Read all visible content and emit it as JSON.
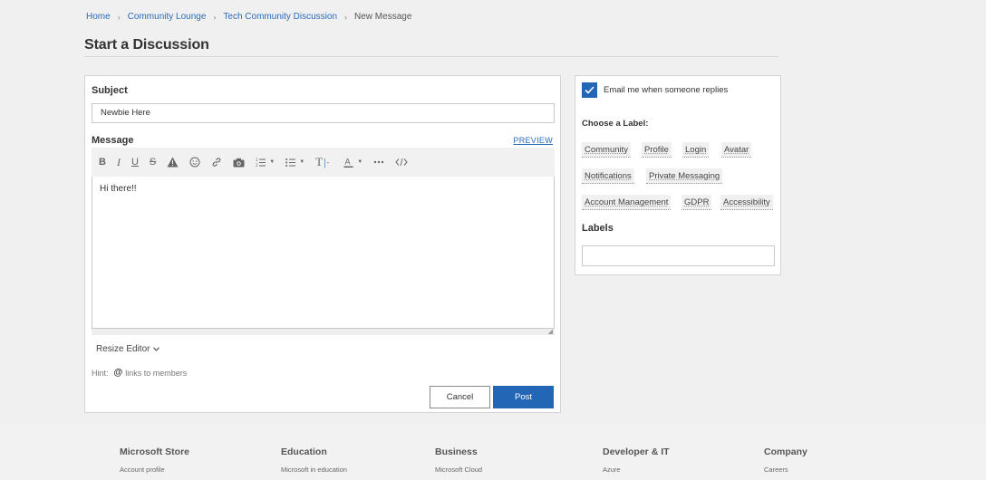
{
  "breadcrumb": {
    "home": "Home",
    "lounge": "Community Lounge",
    "discussion": "Tech Community Discussion",
    "current": "New Message"
  },
  "page_title": "Start a Discussion",
  "compose": {
    "subject_label": "Subject",
    "subject_value": "Newbie Here",
    "message_label": "Message",
    "preview_label": "PREVIEW",
    "toolbar": {
      "bold": "B",
      "italic": "I",
      "underline": "U",
      "strike": "S",
      "font_size": "T"
    },
    "editor_text": "Hi there!!",
    "resize_label": "Resize Editor",
    "hint_prefix": "Hint:",
    "hint_at": "@",
    "hint_text": "links to members",
    "cancel_label": "Cancel",
    "post_label": "Post"
  },
  "sidebar": {
    "email_checked": true,
    "email_label": "Email me when someone replies",
    "choose_label": "Choose a Label:",
    "tags": [
      "Community",
      "Profile",
      "Login",
      "Avatar",
      "Notifications",
      "Private Messaging",
      "Account Management",
      "GDPR",
      "Accessibility"
    ],
    "labels_title": "Labels",
    "labels_value": ""
  },
  "footer": {
    "columns": [
      {
        "heading": "Microsoft Store",
        "link": "Account profile"
      },
      {
        "heading": "Education",
        "link": "Microsoft in education"
      },
      {
        "heading": "Business",
        "link": "Microsoft Cloud"
      },
      {
        "heading": "Developer & IT",
        "link": "Azure"
      },
      {
        "heading": "Company",
        "link": "Careers"
      }
    ]
  },
  "colors": {
    "accent": "#2366b6",
    "link": "#2a6ab7",
    "background": "#f1f0f0"
  }
}
